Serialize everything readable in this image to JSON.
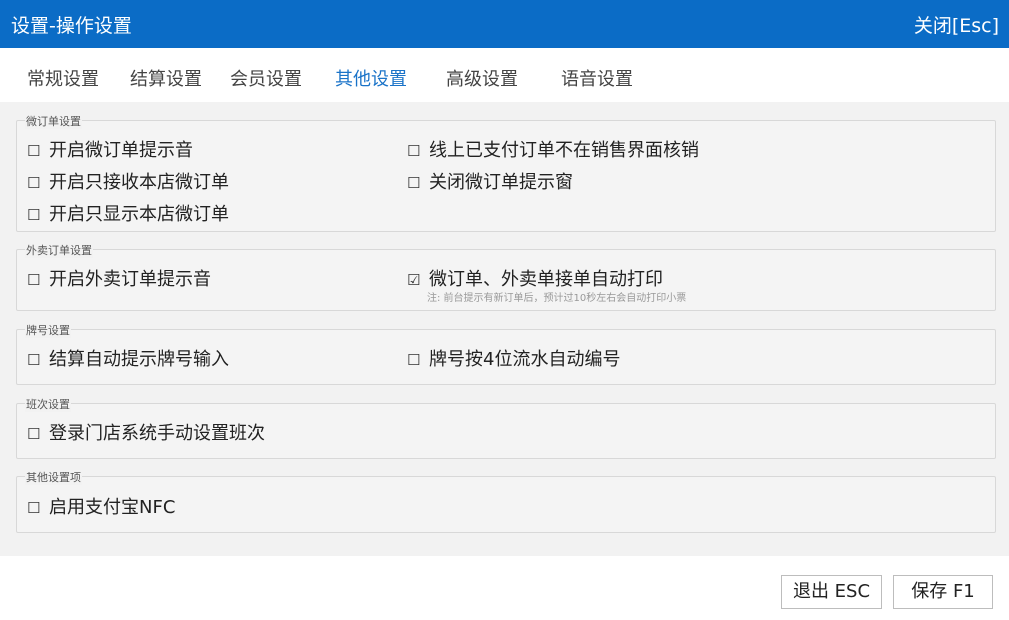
{
  "window": {
    "title": "设置-操作设置",
    "close_label": "关闭[Esc]"
  },
  "tabs": [
    {
      "label": "常规设置"
    },
    {
      "label": "结算设置"
    },
    {
      "label": "会员设置"
    },
    {
      "label": "其他设置",
      "active": true
    },
    {
      "label": "高级设置"
    },
    {
      "label": "语音设置"
    }
  ],
  "groups": {
    "micro_order": {
      "legend": "微订单设置",
      "options": [
        {
          "label": "开启微订单提示音",
          "checked": false,
          "mark": "☐"
        },
        {
          "label": "线上已支付订单不在销售界面核销",
          "checked": false,
          "mark": "☐"
        },
        {
          "label": "开启只接收本店微订单",
          "checked": false,
          "mark": "☐"
        },
        {
          "label": "关闭微订单提示窗",
          "checked": false,
          "mark": "☐"
        },
        {
          "label": "开启只显示本店微订单",
          "checked": false,
          "mark": "☐"
        }
      ]
    },
    "takeout": {
      "legend": "外卖订单设置",
      "options": [
        {
          "label": "开启外卖订单提示音",
          "checked": false,
          "mark": "☐"
        },
        {
          "label": "微订单、外卖单接单自动打印",
          "checked": true,
          "mark": "☑"
        }
      ],
      "note": "注: 前台提示有新订单后，预计过10秒左右会自动打印小票"
    },
    "plate": {
      "legend": "牌号设置",
      "options": [
        {
          "label": "结算自动提示牌号输入",
          "checked": false,
          "mark": "☐"
        },
        {
          "label": "牌号按4位流水自动编号",
          "checked": false,
          "mark": "☐"
        }
      ]
    },
    "shift": {
      "legend": "班次设置",
      "options": [
        {
          "label": "登录门店系统手动设置班次",
          "checked": false,
          "mark": "☐"
        }
      ]
    },
    "other": {
      "legend": "其他设置项",
      "options": [
        {
          "label": "启用支付宝NFC",
          "checked": false,
          "mark": "☐"
        }
      ]
    }
  },
  "buttons": {
    "exit_label": "退出 ESC",
    "save_label": "保存 F1"
  }
}
